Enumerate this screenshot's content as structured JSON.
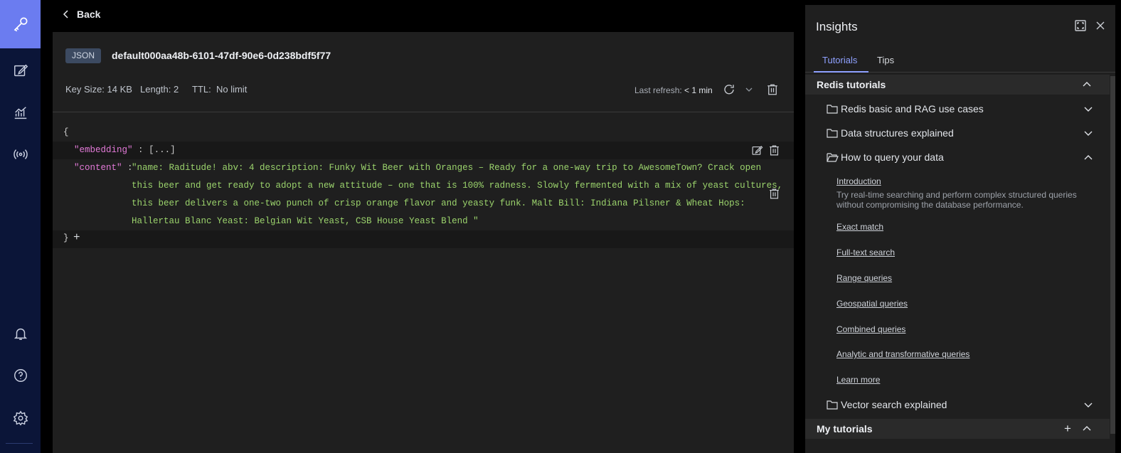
{
  "nav": {
    "items": [
      "key-icon",
      "edit-icon",
      "analytics-icon",
      "pubsub-icon",
      "bell-icon",
      "help-icon",
      "gear-icon"
    ],
    "accent": "#6b7cf0"
  },
  "header": {
    "back_label": "Back"
  },
  "key": {
    "type": "JSON",
    "name": "default000aa48b-6101-47df-90e6-0d238bdf5f77",
    "key_size_label": "Key Size:",
    "key_size": "14 KB",
    "length_label": "Length:",
    "length": "2",
    "ttl_label": "TTL:",
    "ttl": "No limit",
    "last_refresh_label": "Last refresh:",
    "last_refresh": "< 1 min"
  },
  "json": {
    "open_brace": "{",
    "close_brace": "}",
    "add": "+",
    "fields": [
      {
        "key": "\"embedding\"",
        "sep": ":",
        "value": "[...]"
      },
      {
        "key": "\"content\"",
        "sep": ":",
        "value_lines": [
          "\"name: Raditude! abv: 4 description: Funky Wit Beer with Oranges – Ready for a one-way trip to AwesomeTown? Crack open",
          "this beer and get ready to adopt a new attitude – one that is 100% radness. Slowly fermented with a mix of yeast cultures,",
          "this beer delivers a one-two punch of crisp orange flavor and yeasty funk. Malt Bill: Indiana Pilsner & Wheat Hops:",
          "Hallertau Blanc Yeast: Belgian Wit Yeast, CSB House Yeast Blend \""
        ]
      }
    ]
  },
  "insights": {
    "title": "Insights",
    "tabs": [
      "Tutorials",
      "Tips"
    ],
    "redis_tutorials": {
      "label": "Redis tutorials",
      "folders": [
        "Redis basic and RAG use cases",
        "Data structures explained",
        "How to query your data",
        "Vector search explained"
      ],
      "query_links": {
        "intro": "Introduction",
        "intro_desc": "Try real-time searching and perform complex structured queries without compromising the database performance.",
        "items": [
          "Exact match",
          "Full-text search",
          "Range queries",
          "Geospatial queries",
          "Combined queries",
          "Analytic and transformative queries",
          "Learn more"
        ]
      }
    },
    "my_tutorials": {
      "label": "My tutorials",
      "add": "+"
    }
  }
}
